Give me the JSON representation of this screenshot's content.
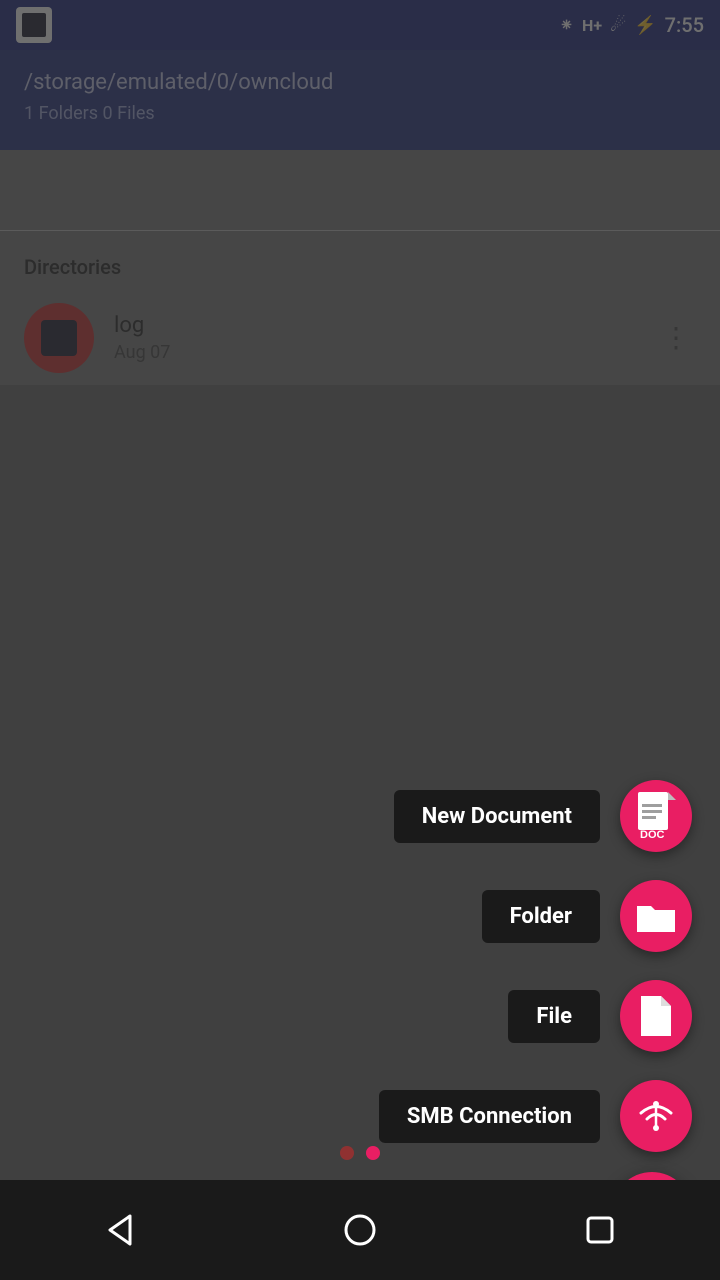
{
  "statusBar": {
    "time": "7:55",
    "bluetooth": "⚡",
    "signal": "H+"
  },
  "header": {
    "path": "/storage/emulated/0/owncloud",
    "info": "1 Folders 0 Files"
  },
  "sections": {
    "directoriesLabel": "Directories"
  },
  "directory": {
    "name": "log",
    "date": "Aug 07"
  },
  "fabMenu": {
    "newDocumentLabel": "New Document",
    "folderLabel": "Folder",
    "fileLabel": "File",
    "smbLabel": "SMB Connection"
  },
  "colors": {
    "pink": "#e91e63",
    "darkBg": "#1a1a1a",
    "headerBg": "#1e2d7d"
  },
  "navBar": {
    "back": "◁",
    "home": "○",
    "recent": "□"
  }
}
